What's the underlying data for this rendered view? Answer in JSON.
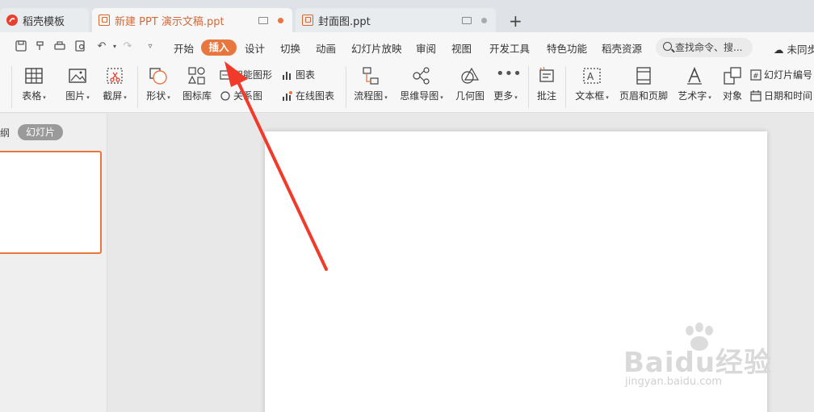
{
  "tabs": {
    "daoke": "稻壳模板",
    "active": "新建 PPT 演示文稿.ppt",
    "cover": "封面图.ppt"
  },
  "menu": {
    "items": [
      "开始",
      "插入",
      "设计",
      "切换",
      "动画",
      "幻灯片放映",
      "审阅",
      "视图",
      "开发工具",
      "特色功能",
      "稻壳资源"
    ],
    "active_index": 1,
    "search_placeholder": "查找命令、搜...",
    "cloud": "未同步"
  },
  "ribbon": {
    "table": "表格",
    "picture": "图片",
    "screenshot": "截屏",
    "shape": "形状",
    "icon_lib": "图标库",
    "smart_shape": "智能图形",
    "chart": "图表",
    "relation": "关系图",
    "online_chart": "在线图表",
    "flowchart": "流程图",
    "mindmap": "思维导图",
    "geometry": "几何图",
    "more": "更多",
    "comment": "批注",
    "textbox": "文本框",
    "header_footer": "页眉和页脚",
    "wordart": "艺术字",
    "object": "对象",
    "slide_number": "幻灯片编号",
    "datetime": "日期和时间"
  },
  "left_panel": {
    "outline_tab": "纲",
    "slides_tab": "幻灯片"
  },
  "watermark": {
    "logo": "Baidu经验",
    "url": "jingyan.baidu.com"
  },
  "colors": {
    "accent": "#e8763f",
    "arrow": "#f23a2a",
    "tab_text_active": "#d26a3a"
  }
}
